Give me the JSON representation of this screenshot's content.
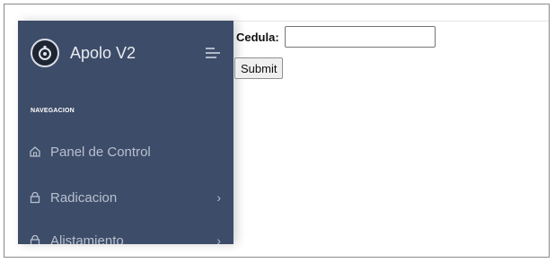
{
  "sidebar": {
    "brand_name": "Apolo V2",
    "section_label": "NAVEGACION",
    "items": [
      {
        "label": "Panel de Control",
        "icon": "home-icon",
        "has_chevron": false
      },
      {
        "label": "Radicacion",
        "icon": "lock-icon",
        "has_chevron": true
      },
      {
        "label": "Alistamiento",
        "icon": "lock-icon",
        "has_chevron": true
      }
    ],
    "chevron": "›",
    "colors": {
      "background": "#3d4c68",
      "text": "#b7c0cf"
    }
  },
  "form": {
    "cedula_label": "Cedula:",
    "cedula_value": "",
    "submit_label": "Submit"
  }
}
